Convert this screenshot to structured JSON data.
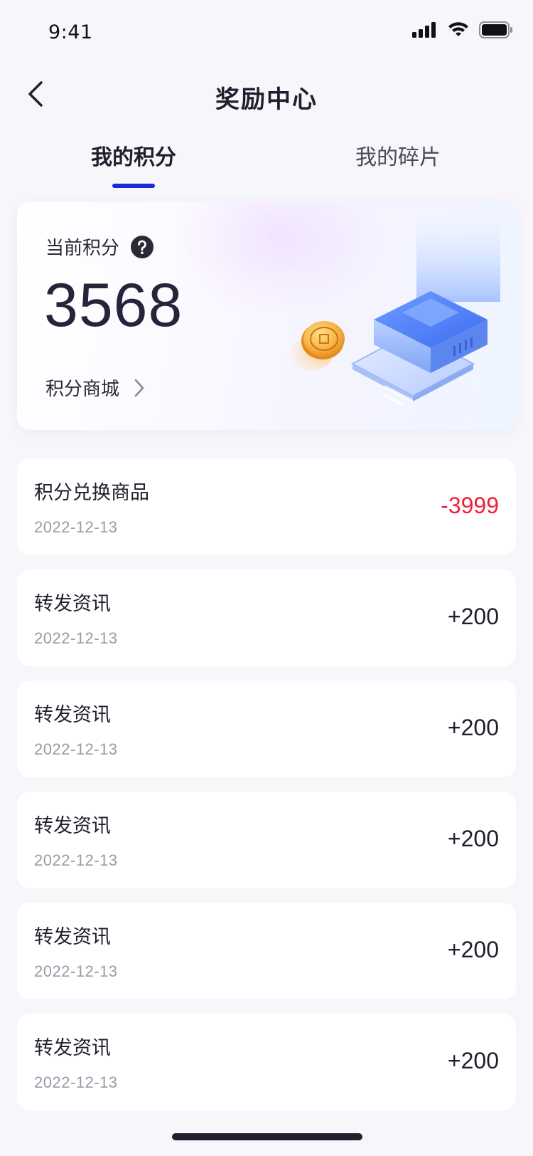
{
  "status_bar": {
    "time": "9:41"
  },
  "nav": {
    "title": "奖励中心"
  },
  "tabs": [
    {
      "label": "我的积分",
      "active": true
    },
    {
      "label": "我的碎片",
      "active": false
    }
  ],
  "points_card": {
    "label": "当前积分",
    "value": "3568",
    "mall_link": "积分商城"
  },
  "records": [
    {
      "title": "积分兑换商品",
      "date": "2022-12-13",
      "amount": "-3999",
      "negative": true
    },
    {
      "title": "转发资讯",
      "date": "2022-12-13",
      "amount": "+200",
      "negative": false
    },
    {
      "title": "转发资讯",
      "date": "2022-12-13",
      "amount": "+200",
      "negative": false
    },
    {
      "title": "转发资讯",
      "date": "2022-12-13",
      "amount": "+200",
      "negative": false
    },
    {
      "title": "转发资讯",
      "date": "2022-12-13",
      "amount": "+200",
      "negative": false
    },
    {
      "title": "转发资讯",
      "date": "2022-12-13",
      "amount": "+200",
      "negative": false
    }
  ],
  "colors": {
    "accent": "#1c2bd6",
    "negative": "#f0203a",
    "text": "#1f1f2e",
    "muted": "#9a9aa8"
  }
}
